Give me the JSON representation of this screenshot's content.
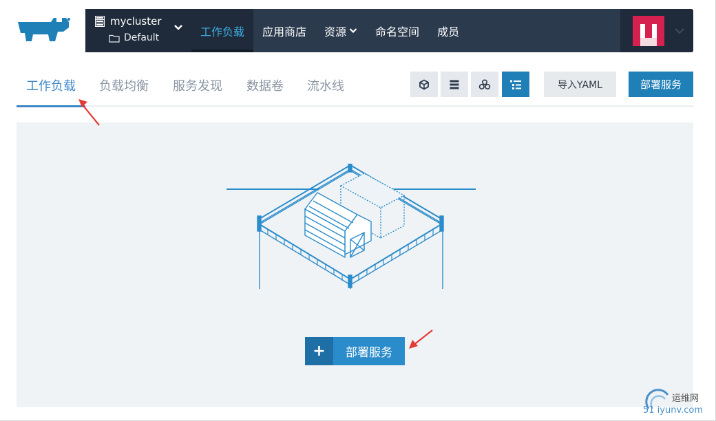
{
  "header": {
    "cluster_name": "mycluster",
    "project_name": "Default",
    "nav": [
      {
        "label": "工作负载",
        "active": true
      },
      {
        "label": "应用商店",
        "active": false
      },
      {
        "label": "资源",
        "active": false,
        "dropdown": true
      },
      {
        "label": "命名空间",
        "active": false
      },
      {
        "label": "成员",
        "active": false
      }
    ]
  },
  "subtabs": [
    {
      "label": "工作负载",
      "active": true
    },
    {
      "label": "负载均衡",
      "active": false
    },
    {
      "label": "服务发现",
      "active": false
    },
    {
      "label": "数据卷",
      "active": false
    },
    {
      "label": "流水线",
      "active": false
    }
  ],
  "toolbar": {
    "view_buttons": [
      {
        "icon": "cube-icon",
        "active": false
      },
      {
        "icon": "list-icon",
        "active": false
      },
      {
        "icon": "node-group-icon",
        "active": false
      },
      {
        "icon": "tree-list-icon",
        "active": true
      }
    ],
    "import_yaml_label": "导入YAML",
    "deploy_label": "部署服务"
  },
  "empty_state": {
    "cta_icon": "+",
    "cta_label": "部署服务"
  },
  "watermark": {
    "line1": "运维网",
    "line2": "51 iyunv.com"
  },
  "colors": {
    "topbar": "#2b3a4d",
    "accent": "#1f7fb7",
    "active_tab": "#3d86c6",
    "annotation_arrow": "#e53935"
  }
}
